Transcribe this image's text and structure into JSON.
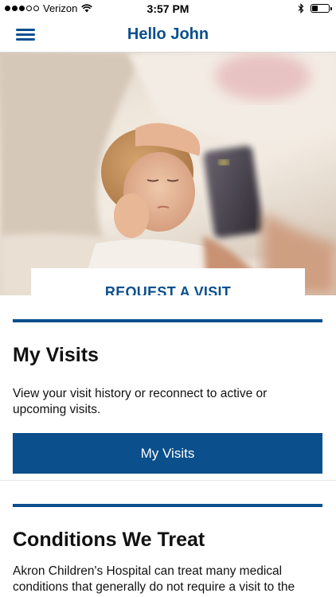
{
  "status_bar": {
    "carrier": "Verizon",
    "time": "3:57 PM",
    "signal_bars_filled": 3,
    "signal_bars_total": 5,
    "battery_level": 0.35
  },
  "nav": {
    "title": "Hello John",
    "menu_icon": "hamburger-menu-icon"
  },
  "hero": {
    "request_button_label": "REQUEST A VISIT"
  },
  "my_visits": {
    "title": "My Visits",
    "description": "View your visit history or reconnect to active or upcoming visits.",
    "button_label": "My Visits"
  },
  "conditions": {
    "title": "Conditions We Treat",
    "description": "Akron Children's Hospital can treat many medical conditions that generally do not require a visit to the"
  },
  "colors": {
    "brand_blue": "#0b4f8d",
    "background": "#ffffff"
  }
}
